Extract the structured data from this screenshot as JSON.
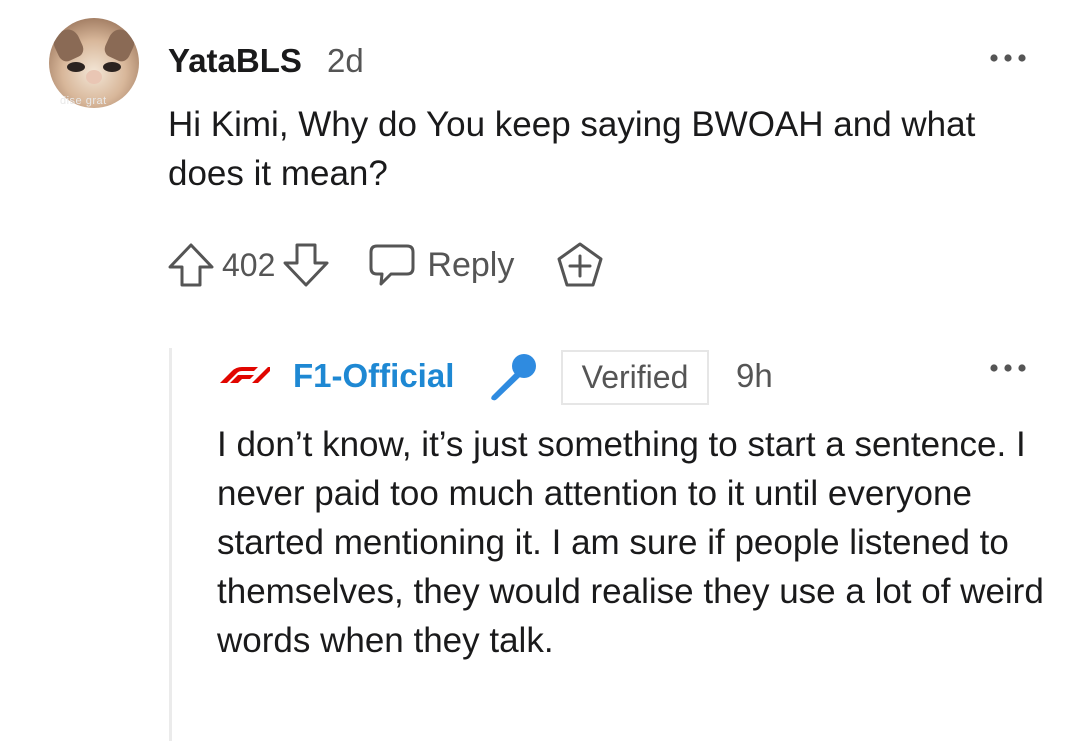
{
  "comment": {
    "avatar_caption": "dise grat",
    "username": "YataBLS",
    "age": "2d",
    "more_icon": "more-dots-icon",
    "text": "Hi Kimi, Why do You keep saying BWOAH and what does it mean?",
    "actions": {
      "upvote_icon": "upvote-arrow-icon",
      "vote_count": "402",
      "downvote_icon": "downvote-arrow-icon",
      "reply_icon": "speech-bubble-icon",
      "reply_label": "Reply",
      "award_icon": "add-award-icon"
    }
  },
  "reply": {
    "logo_icon": "f1-logo-icon",
    "username": "F1-Official",
    "flair_icon": "microphone-icon",
    "badge": "Verified",
    "age": "9h",
    "more_icon": "more-dots-icon",
    "text": "I don’t know, it’s just something to start a sentence. I never paid too much attention to it until everyone started mentioning it. I am sure if people listened to themselves, they would realise they use a lot of weird words when they talk."
  },
  "colors": {
    "username_link": "#1e88d3",
    "f1_red": "#e10600",
    "muted": "#555555",
    "mic_blue": "#2f8be0"
  }
}
